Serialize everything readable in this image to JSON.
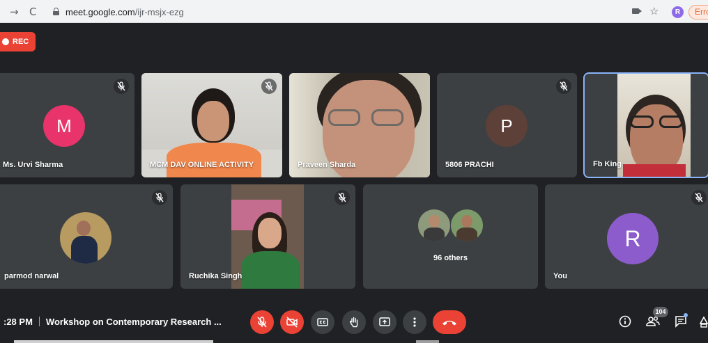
{
  "browser": {
    "url_host": "meet.google.com",
    "url_path": "/ijr-msjx-ezg",
    "profile_initial": "R",
    "error_label": "Error"
  },
  "recording": {
    "label": "REC"
  },
  "tiles": [
    {
      "name": "Ms. Urvi Sharma",
      "initial": "M",
      "avatar_color": "#e8336b",
      "muted": true
    },
    {
      "name": "MCM DAV ONLINE ACTIVITY",
      "muted": true
    },
    {
      "name": "Praveen Sharda",
      "muted": false
    },
    {
      "name": "5806 PRACHI",
      "initial": "P",
      "avatar_color": "#5d4037",
      "muted": true
    },
    {
      "name": "Fb King",
      "muted": false
    },
    {
      "name": "parmod narwal",
      "muted": true
    },
    {
      "name": "Ruchika Singh",
      "muted": true
    },
    {
      "name": "96 others",
      "muted": false
    },
    {
      "name": "You",
      "initial": "R",
      "avatar_color": "#8d5ccc",
      "muted": true
    }
  ],
  "footer": {
    "time": ":28 PM",
    "meeting_title": "Workshop on Contemporary Research ...",
    "participant_count": "104"
  },
  "controls": [
    {
      "icon": "mic-off-icon",
      "state": "off"
    },
    {
      "icon": "camera-off-icon",
      "state": "off"
    },
    {
      "icon": "captions-icon"
    },
    {
      "icon": "raise-hand-icon"
    },
    {
      "icon": "present-screen-icon"
    },
    {
      "icon": "more-options-icon"
    },
    {
      "icon": "hang-up-icon"
    }
  ],
  "colors": {
    "background": "#202124",
    "tile": "#3c4043",
    "danger": "#ea4335",
    "active_outline": "#8ab4f8"
  }
}
